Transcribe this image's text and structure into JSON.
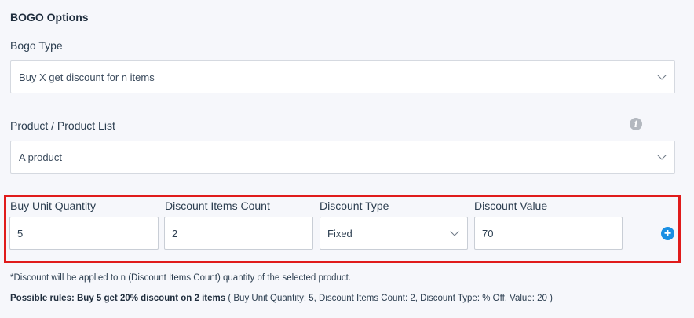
{
  "section": {
    "title": "BOGO Options"
  },
  "bogo_type": {
    "label": "Bogo Type",
    "selected": "Buy X get discount for n items"
  },
  "product": {
    "label": "Product / Product List",
    "selected": "A product",
    "info_icon": "info-icon"
  },
  "fields": {
    "buy_unit_quantity": {
      "label": "Buy Unit Quantity",
      "value": "5"
    },
    "discount_items_count": {
      "label": "Discount Items Count",
      "value": "2"
    },
    "discount_type": {
      "label": "Discount Type",
      "selected": "Fixed"
    },
    "discount_value": {
      "label": "Discount Value",
      "value": "70"
    }
  },
  "add_icon": "plus-circle-icon",
  "note": "*Discount will be applied to n (Discount Items Count) quantity of the selected product.",
  "rules": {
    "title": "Possible rules: Buy 5 get 20% discount on 2 items",
    "detail": " ( Buy Unit Quantity: 5, Discount Items Count: 2, Discount Type: % Off, Value: 20 )"
  },
  "colors": {
    "highlight_border": "#e01b1b",
    "accent": "#1a8fe3"
  }
}
